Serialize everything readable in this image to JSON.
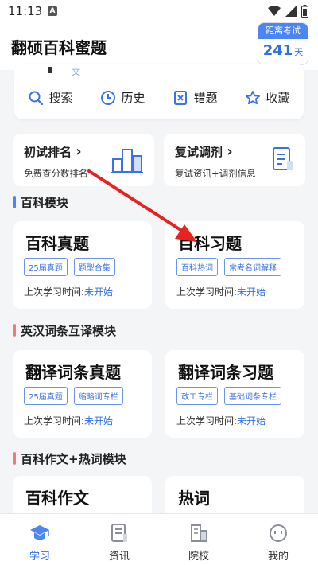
{
  "status_bar": {
    "time": "11:13",
    "notif": "A"
  },
  "header": {
    "title": "翻硕百科蜜题",
    "countdown": {
      "label": "距离考试",
      "days": "241",
      "unit": "天"
    }
  },
  "quick_actions": [
    {
      "label": "搜索",
      "icon": "search-icon"
    },
    {
      "label": "历史",
      "icon": "clock-icon"
    },
    {
      "label": "错题",
      "icon": "wrong-questions-icon"
    },
    {
      "label": "收藏",
      "icon": "star-icon"
    }
  ],
  "peek_text": "文",
  "rank_cards": [
    {
      "title": "初试排名",
      "subtitle": "免费查分数排名",
      "icon": "podium-icon"
    },
    {
      "title": "复试调剂",
      "subtitle": "复试资讯+调剂信息",
      "icon": "document-icon"
    }
  ],
  "sections": [
    {
      "title": "百科模块",
      "cards": [
        {
          "title": "百科真题",
          "tags": [
            "25届真题",
            "题型合集"
          ],
          "last_label": "上次学习时间:",
          "last_value": "未开始"
        },
        {
          "title": "百科习题",
          "tags": [
            "百科热词",
            "常考名词解释"
          ],
          "last_label": "上次学习时间:",
          "last_value": "未开始"
        }
      ]
    },
    {
      "title": "英汉词条互译模块",
      "cards": [
        {
          "title": "翻译词条真题",
          "tags": [
            "25届真题",
            "缩略词专栏"
          ],
          "last_label": "上次学习时间:",
          "last_value": "未开始"
        },
        {
          "title": "翻译词条习题",
          "tags": [
            "政工专栏",
            "基础词条专栏"
          ],
          "last_label": "上次学习时间:",
          "last_value": "未开始"
        }
      ]
    },
    {
      "title": "百科作文+热词模块",
      "cards": [
        {
          "title": "百科作文"
        },
        {
          "title": "热词"
        }
      ]
    }
  ],
  "tabbar": [
    {
      "label": "学习",
      "icon": "graduation-cap-icon",
      "active": true
    },
    {
      "label": "资讯",
      "icon": "news-icon",
      "active": false
    },
    {
      "label": "院校",
      "icon": "building-icon",
      "active": false
    },
    {
      "label": "我的",
      "icon": "smiley-icon",
      "active": false
    }
  ],
  "colors": {
    "accent": "#2f6fe8",
    "section_blue": "#4d86f3",
    "section_red": "#f07a7a",
    "arrow": "#e8231f"
  }
}
